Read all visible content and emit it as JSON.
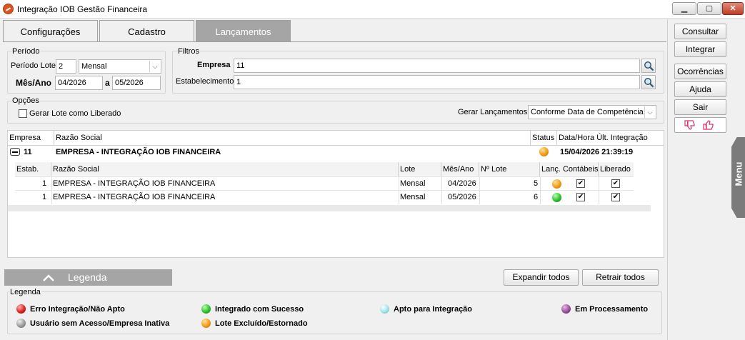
{
  "window": {
    "title": "Integração IOB Gestão Financeira"
  },
  "tabs": [
    {
      "label": "Configurações",
      "active": false
    },
    {
      "label": "Cadastro",
      "active": false
    },
    {
      "label": "Lançamentos",
      "active": true
    }
  ],
  "periodo": {
    "group_label": "Período",
    "periodo_lote_label": "Período Lote",
    "periodo_lote_value": "2",
    "periodo_tipo_value": "Mensal",
    "mes_ano_label": "Mês/Ano",
    "mes_ano_inicio": "04/2026",
    "a_label": "a",
    "mes_ano_fim": "05/2026"
  },
  "filtros": {
    "group_label": "Filtros",
    "empresa_label": "Empresa",
    "empresa_value": "11",
    "estabelecimento_label": "Estabelecimento",
    "estabelecimento_value": "1"
  },
  "opcoes": {
    "group_label": "Opções",
    "gerar_lote_label": "Gerar Lote como Liberado",
    "gerar_lote_checked": false,
    "gerar_lancamentos_label": "Gerar Lançamentos",
    "gerar_lancamentos_value": "Conforme Data de Competência"
  },
  "grid": {
    "headers": [
      "Empresa",
      "Razão Social",
      "Status",
      "Data/Hora Últ. Integração"
    ],
    "company": {
      "code": "11",
      "name": "EMPRESA - INTEGRAÇÃO IOB FINANCEIRA",
      "status": "orange",
      "datetime": "15/04/2026 21:39:19"
    },
    "sub_headers": [
      "Estab.",
      "Razão Social",
      "Lote",
      "Mês/Ano",
      "Nº Lote",
      "Lanç. Contábeis",
      "Liberado"
    ],
    "rows": [
      {
        "estab": "1",
        "razao": "EMPRESA - INTEGRAÇÃO IOB FINANCEIRA",
        "lote": "Mensal",
        "mes_ano": "04/2026",
        "num_lote": "5",
        "status": "orange",
        "contabeis": true,
        "liberado": true
      },
      {
        "estab": "1",
        "razao": "EMPRESA - INTEGRAÇÃO IOB FINANCEIRA",
        "lote": "Mensal",
        "mes_ano": "05/2026",
        "num_lote": "6",
        "status": "green",
        "contabeis": true,
        "liberado": true
      }
    ]
  },
  "sidebar": {
    "buttons": [
      "Consultar",
      "Integrar",
      "Ocorrências",
      "Ajuda",
      "Sair"
    ],
    "menu_label": "Menu"
  },
  "bottom": {
    "legend_toggle_label": "Legenda",
    "expand_label": "Expandir todos",
    "retract_label": "Retrair todos"
  },
  "legend": {
    "group_label": "Legenda",
    "items": [
      {
        "label": "Erro Integração/Não Apto",
        "color": "#e02020"
      },
      {
        "label": "Integrado com Sucesso",
        "color": "#2ec22e"
      },
      {
        "label": "Apto para Integração",
        "color": "#9ee3ea"
      },
      {
        "label": "Em Processamento",
        "color": "#9b4f9b"
      },
      {
        "label": "Usuário sem Acesso/Empresa Inativa",
        "color": "#9c9c9c"
      },
      {
        "label": "Lote Excluído/Estornado",
        "color": "#f39c12"
      }
    ]
  }
}
